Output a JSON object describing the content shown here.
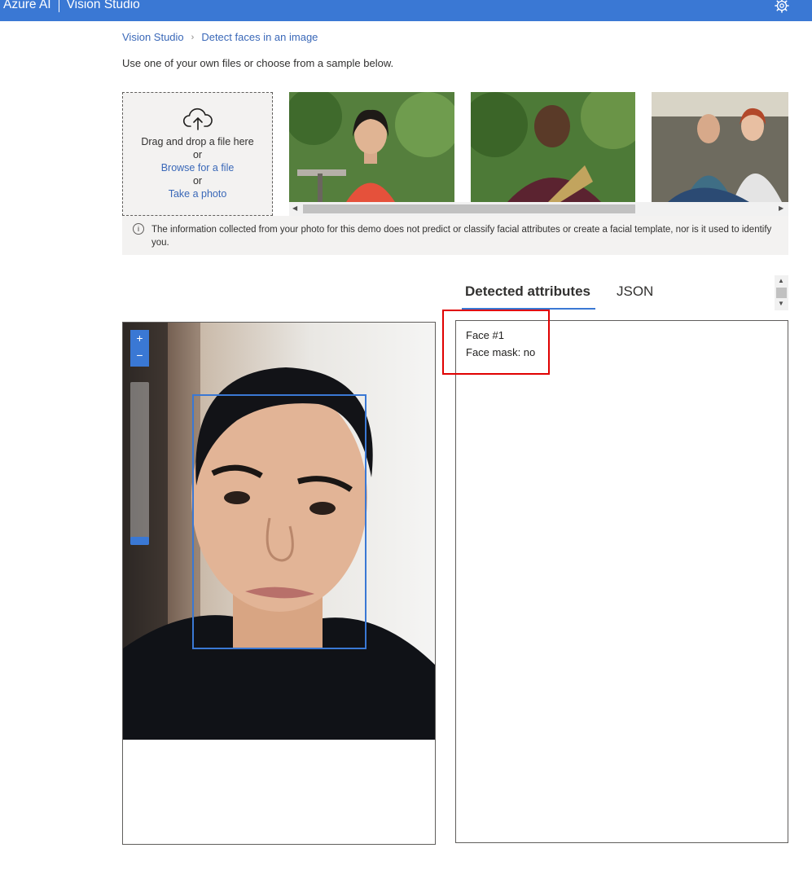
{
  "topbar": {
    "brand_primary": "Azure AI",
    "brand_secondary": "Vision Studio",
    "settings_icon": "gear-icon"
  },
  "breadcrumb": {
    "home": "Vision Studio",
    "current": "Detect faces in an image",
    "separator_icon": "chevron-right-icon"
  },
  "intro_text": "Use one of your own files or choose from a sample below.",
  "upload": {
    "icon": "cloud-upload-icon",
    "line1": "Drag and drop a file here",
    "or1": "or",
    "browse": "Browse for a file",
    "or2": "or",
    "take_photo": "Take a photo"
  },
  "samples": {
    "count": 3,
    "items": [
      {
        "icon": "sample-photo-woman-red-top"
      },
      {
        "icon": "sample-photo-man-with-fan"
      },
      {
        "icon": "sample-photo-two-women"
      }
    ]
  },
  "notice": {
    "icon": "info-icon",
    "text": "The information collected from your photo for this demo does not predict or classify facial attributes or create a facial template, nor is it used to identify you."
  },
  "tabs": [
    {
      "label": "Detected attributes",
      "selected": true
    },
    {
      "label": "JSON",
      "selected": false
    }
  ],
  "viewer": {
    "zoom_in": "+",
    "zoom_out": "−",
    "zoom_level": 0.0
  },
  "results": {
    "face_title": "Face #1",
    "face_mask": "Face mask: no"
  },
  "colors": {
    "accent": "#3a78d4",
    "highlight": "#e00000"
  }
}
